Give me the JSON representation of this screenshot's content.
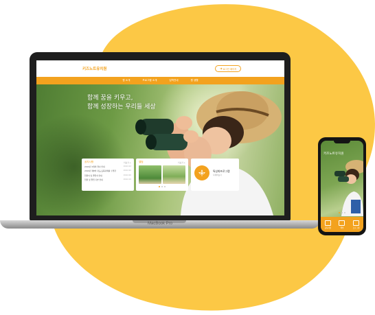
{
  "site": {
    "logo": "키즈노트유치원",
    "login": "로그인 페이지",
    "nav": [
      "원 소개",
      "프로그램 소개",
      "입학안내",
      "원 생활"
    ],
    "hero_line1": "함께 꿈을 키우고,",
    "hero_line2": "함께 성장하는 우리들 세상"
  },
  "notice": {
    "title": "공지사항",
    "more": "더보기 +",
    "items": [
      {
        "text": "2019년 2월의 행사 안내",
        "date": "19.02.22"
      },
      {
        "text": "2019년 제8차 지도/교육과제를 수행한",
        "date": "19.02.20"
      },
      {
        "text": "입원식 및 졸업식 안내",
        "date": "19.02.20"
      },
      {
        "text": "입원 및 졸업 기본 안내",
        "date": "19.02.19"
      }
    ]
  },
  "gallery": {
    "title": "앨범",
    "more": "더보기 +"
  },
  "program": {
    "name": "특성화프로그램",
    "sub": "자세히보기"
  },
  "laptop": {
    "brand": "MacBook Pro"
  },
  "phone": {
    "logo": "키즈노트유치원",
    "bar": [
      "공지사항",
      "앨범",
      "프로그램"
    ]
  },
  "colors": {
    "accent": "#f3a21e",
    "blob": "#fcc845"
  },
  "icons": {
    "login": "login-arrow-icon",
    "program": "flower-icon"
  }
}
